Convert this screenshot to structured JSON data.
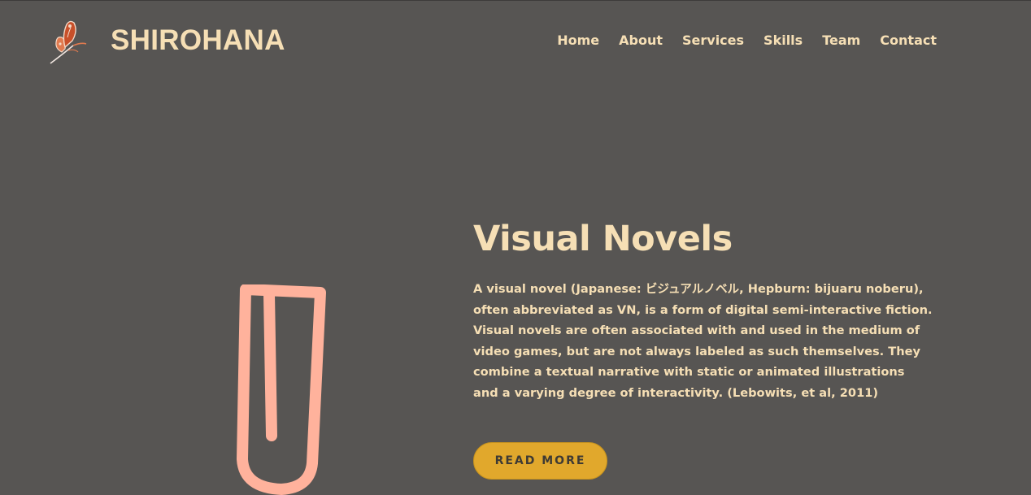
{
  "header": {
    "logo_icon": "butterfly-icon",
    "brand": "SHIROHANA",
    "nav": [
      "Home",
      "About",
      "Services",
      "Skills",
      "Team",
      "Contact"
    ]
  },
  "hero": {
    "illustration_icon": "paperclip-icon",
    "title": "Visual Novels",
    "description": "A visual novel (Japanese: ビジュアルノベル, Hepburn: bijuaru noberu), often abbreviated as VN, is a form of digital semi-interactive fiction. Visual novels are often associated with and used in the medium of video games, but are not always labeled as such themselves. They combine a textual narrative with static or animated illustrations and a varying degree of interactivity. (Lebowits, et al, 2011)",
    "button": "READ MORE"
  },
  "colors": {
    "background": "#575553",
    "text": "#f6dfb5",
    "accent": "#e1a82c",
    "illustration": "#ffb29c"
  }
}
